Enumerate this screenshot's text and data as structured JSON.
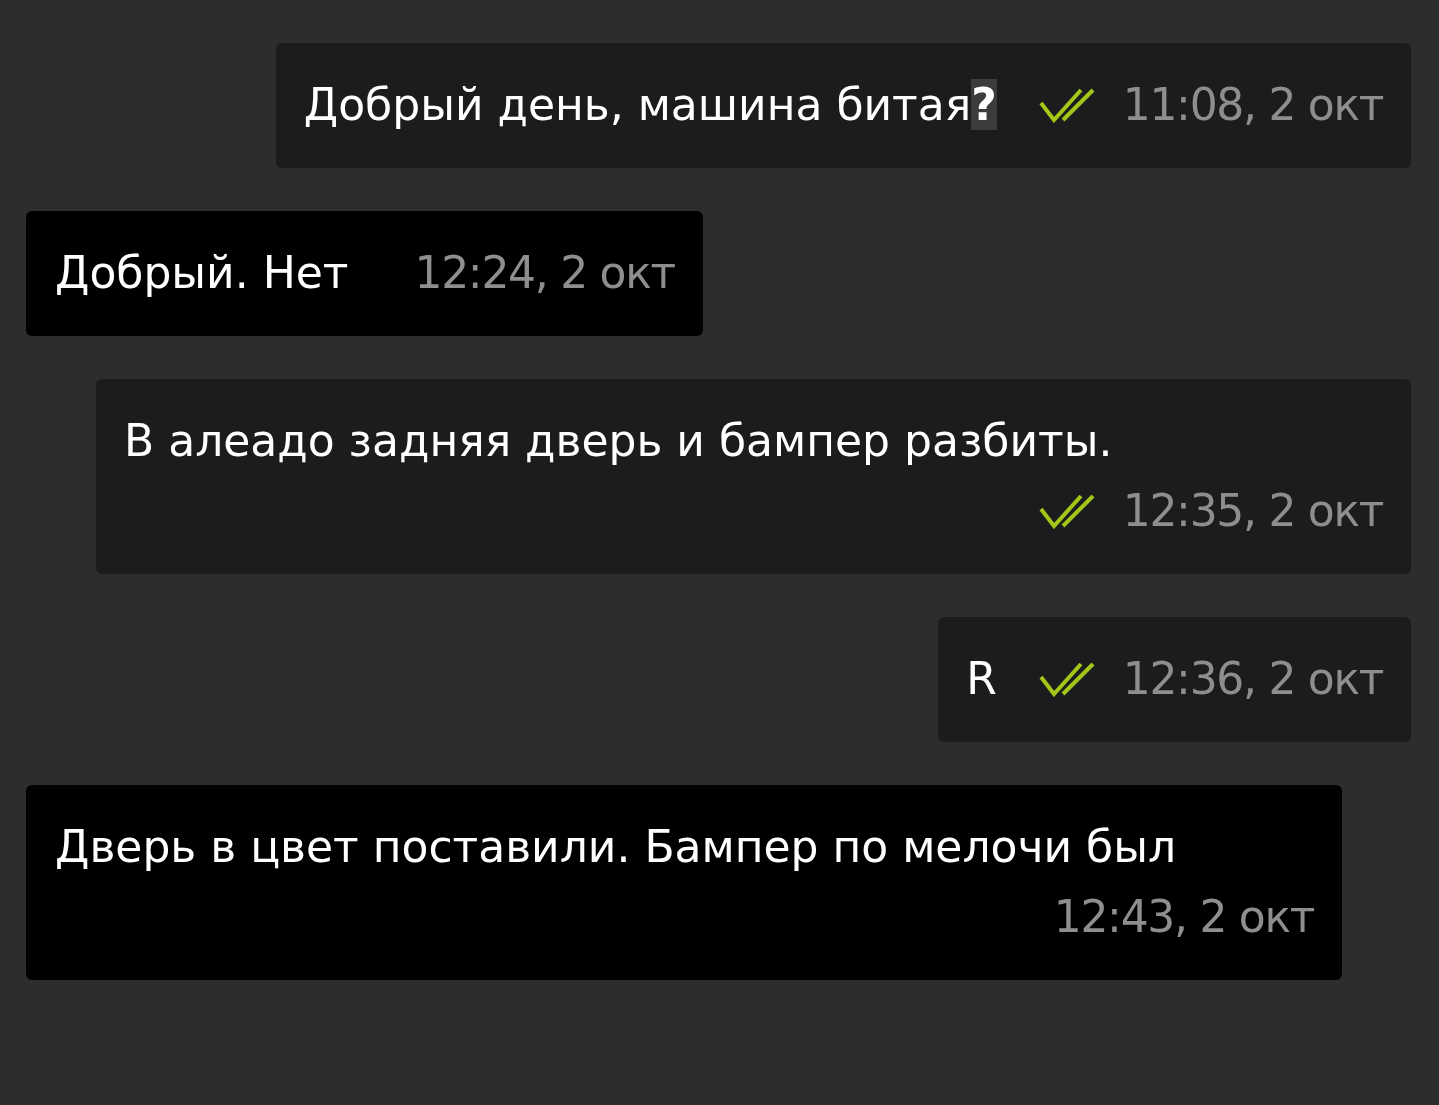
{
  "messages": [
    {
      "kind": "outgoing",
      "text": "Добрый день, машина битая**?**",
      "read": true,
      "time": "11:08, 2 окт"
    },
    {
      "kind": "incoming",
      "text": "Добрый. Нет",
      "time": "12:24, 2 окт"
    },
    {
      "kind": "outgoing",
      "text": "В алеадо задняя дверь и бампер разбиты.",
      "read": true,
      "time": "12:35, 2 окт"
    },
    {
      "kind": "outgoing",
      "text": "R",
      "read": true,
      "time": "12:36, 2 окт"
    },
    {
      "kind": "incoming",
      "text": "Дверь в цвет поставили. Бампер по мелочи был",
      "time": "12:43, 2 окт"
    }
  ]
}
